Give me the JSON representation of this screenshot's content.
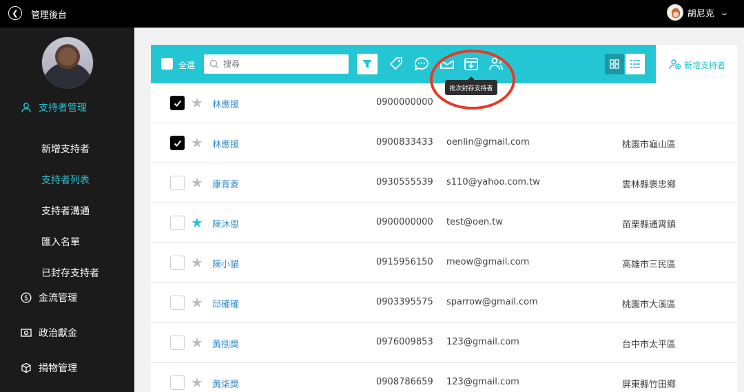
{
  "topbar": {
    "title": "管理後台",
    "user_name": "胡尼克"
  },
  "sidebar": {
    "main_items": [
      {
        "label": "支持者管理"
      },
      {
        "label": "金流管理"
      },
      {
        "label": "政治獻金"
      },
      {
        "label": "捐物管理"
      }
    ],
    "sub_items": [
      {
        "label": "新增支持者"
      },
      {
        "label": "支持者列表"
      },
      {
        "label": "支持者溝通"
      },
      {
        "label": "匯入名單"
      },
      {
        "label": "已封存支持者"
      }
    ]
  },
  "toolbar": {
    "select_all_label": "全選",
    "search_placeholder": "搜尋",
    "tooltip": "批次封存支持者",
    "add_supporter_label": "新增支持者"
  },
  "rows": [
    {
      "checked": true,
      "starred": false,
      "name": "林應援",
      "phone": "0900000000",
      "email": "",
      "area": ""
    },
    {
      "checked": true,
      "starred": false,
      "name": "林應援",
      "phone": "0900833433",
      "email": "oenlin@gmail.com",
      "area": "桃園市龜山區"
    },
    {
      "checked": false,
      "starred": false,
      "name": "康育菱",
      "phone": "0930555539",
      "email": "s110@yahoo.com.tw",
      "area": "雲林縣褒忠鄉"
    },
    {
      "checked": false,
      "starred": true,
      "name": "陳沐恩",
      "phone": "0900000000",
      "email": "test@oen.tw",
      "area": "苗栗縣通霄鎮"
    },
    {
      "checked": false,
      "starred": false,
      "name": "陳小貓",
      "phone": "0915956150",
      "email": "meow@gmail.com",
      "area": "高雄市三民區"
    },
    {
      "checked": false,
      "starred": false,
      "name": "邱確確",
      "phone": "0903395575",
      "email": "sparrow@gmail.com",
      "area": "桃園市大溪區"
    },
    {
      "checked": false,
      "starred": false,
      "name": "黃捌獎",
      "phone": "0976009853",
      "email": "123@gmail.com",
      "area": "台中市太平區"
    },
    {
      "checked": false,
      "starred": false,
      "name": "黃柒獎",
      "phone": "0908786659",
      "email": "123@gmail.com",
      "area": "屏東縣竹田鄉"
    }
  ],
  "colors": {
    "accent": "#24c6d4",
    "annotation": "#e53a26",
    "sidebar": "#1b1b1b"
  }
}
